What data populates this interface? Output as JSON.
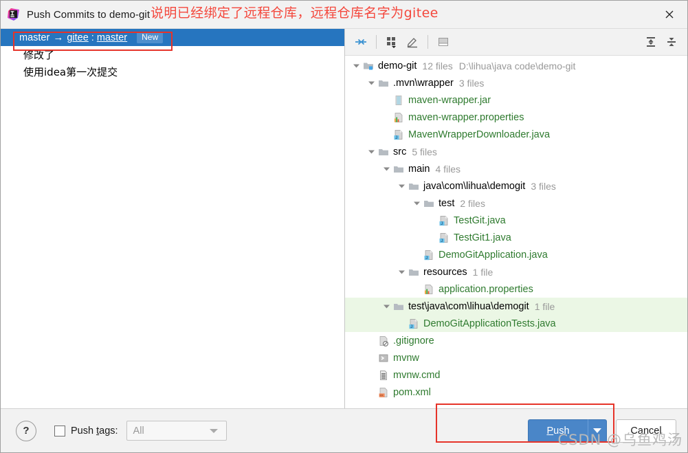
{
  "window": {
    "title": "Push Commits to demo-git",
    "close_label": "×",
    "app_icon": "intellij-idea-icon"
  },
  "annotations": {
    "title_note": "说明已经绑定了远程仓库，远程仓库名字为gitee",
    "note_color": "#f4473c",
    "box_color": "#e63329"
  },
  "commits_panel": {
    "branch_row": {
      "local_branch": "master",
      "arrow": "→",
      "remote": "gitee",
      "separator": ":",
      "remote_branch": "master",
      "badge": "New"
    },
    "messages": [
      "修改了",
      "使用idea第一次提交"
    ]
  },
  "file_toolbar": {
    "buttons": [
      {
        "name": "collapse-diff-icon",
        "label": "Group By"
      },
      {
        "name": "group-by-icon",
        "label": "Group By Directory"
      },
      {
        "name": "edit-icon",
        "label": "Edit Source"
      },
      {
        "name": "preview-icon",
        "label": "Preview Diff"
      },
      {
        "name": "expand-all-icon",
        "label": "Expand All"
      },
      {
        "name": "collapse-all-icon",
        "label": "Collapse All"
      }
    ]
  },
  "file_tree": [
    {
      "indent": 0,
      "twisty": "open",
      "icon": "module-folder-icon",
      "name": "demo-git",
      "kind": "dir",
      "meta": "12 files",
      "path": "D:\\lihua\\java code\\demo-git",
      "highlight": false
    },
    {
      "indent": 1,
      "twisty": "open",
      "icon": "folder-icon",
      "name": ".mvn\\wrapper",
      "kind": "dir",
      "meta": "3 files",
      "path": "",
      "highlight": false
    },
    {
      "indent": 2,
      "twisty": "none",
      "icon": "jar-file-icon",
      "name": "maven-wrapper.jar",
      "kind": "file",
      "meta": "",
      "path": "",
      "highlight": false
    },
    {
      "indent": 2,
      "twisty": "none",
      "icon": "properties-file-icon",
      "name": "maven-wrapper.properties",
      "kind": "file",
      "meta": "",
      "path": "",
      "highlight": false
    },
    {
      "indent": 2,
      "twisty": "none",
      "icon": "java-file-icon",
      "name": "MavenWrapperDownloader.java",
      "kind": "file",
      "meta": "",
      "path": "",
      "highlight": false
    },
    {
      "indent": 1,
      "twisty": "open",
      "icon": "folder-icon",
      "name": "src",
      "kind": "dir",
      "meta": "5 files",
      "path": "",
      "highlight": false
    },
    {
      "indent": 2,
      "twisty": "open",
      "icon": "folder-icon",
      "name": "main",
      "kind": "dir",
      "meta": "4 files",
      "path": "",
      "highlight": false
    },
    {
      "indent": 3,
      "twisty": "open",
      "icon": "folder-icon",
      "name": "java\\com\\lihua\\demogit",
      "kind": "dir",
      "meta": "3 files",
      "path": "",
      "highlight": false
    },
    {
      "indent": 4,
      "twisty": "open",
      "icon": "folder-icon",
      "name": "test",
      "kind": "dir",
      "meta": "2 files",
      "path": "",
      "highlight": false
    },
    {
      "indent": 5,
      "twisty": "none",
      "icon": "java-file-icon",
      "name": "TestGit.java",
      "kind": "file",
      "meta": "",
      "path": "",
      "highlight": false
    },
    {
      "indent": 5,
      "twisty": "none",
      "icon": "java-file-icon",
      "name": "TestGit1.java",
      "kind": "file",
      "meta": "",
      "path": "",
      "highlight": false
    },
    {
      "indent": 4,
      "twisty": "none",
      "icon": "java-file-icon",
      "name": "DemoGitApplication.java",
      "kind": "file",
      "meta": "",
      "path": "",
      "highlight": false
    },
    {
      "indent": 3,
      "twisty": "open",
      "icon": "folder-icon",
      "name": "resources",
      "kind": "dir",
      "meta": "1 file",
      "path": "",
      "highlight": false
    },
    {
      "indent": 4,
      "twisty": "none",
      "icon": "properties-file-icon",
      "name": "application.properties",
      "kind": "file",
      "meta": "",
      "path": "",
      "highlight": false
    },
    {
      "indent": 2,
      "twisty": "open",
      "icon": "folder-icon",
      "name": "test\\java\\com\\lihua\\demogit",
      "kind": "dir",
      "meta": "1 file",
      "path": "",
      "highlight": true
    },
    {
      "indent": 3,
      "twisty": "none",
      "icon": "java-file-icon",
      "name": "DemoGitApplicationTests.java",
      "kind": "file",
      "meta": "",
      "path": "",
      "highlight": true
    },
    {
      "indent": 1,
      "twisty": "none",
      "icon": "gitignore-file-icon",
      "name": ".gitignore",
      "kind": "file",
      "meta": "",
      "path": "",
      "highlight": false
    },
    {
      "indent": 1,
      "twisty": "none",
      "icon": "shell-file-icon",
      "name": "mvnw",
      "kind": "file",
      "meta": "",
      "path": "",
      "highlight": false
    },
    {
      "indent": 1,
      "twisty": "none",
      "icon": "cmd-file-icon",
      "name": "mvnw.cmd",
      "kind": "file",
      "meta": "",
      "path": "",
      "highlight": false
    },
    {
      "indent": 1,
      "twisty": "none",
      "icon": "xml-file-icon",
      "name": "pom.xml",
      "kind": "file",
      "meta": "",
      "path": "",
      "highlight": false
    }
  ],
  "bottom_bar": {
    "help_label": "?",
    "push_tags_checkbox_checked": false,
    "push_tags_label_before": "Push ",
    "push_tags_label_accel": "t",
    "push_tags_label_after": "ags:",
    "tags_select_value": "All",
    "push_button_accel": "P",
    "push_button_rest": "ush",
    "cancel_button": "Cancel"
  },
  "watermark": "CSDN @乌鱼鸡汤",
  "colors": {
    "selection_blue": "#2675bf",
    "push_blue": "#4a86c8",
    "tree_highlight_green": "#ebf7e5",
    "file_green": "#2e7a2e",
    "annotation_red": "#f4473c"
  }
}
